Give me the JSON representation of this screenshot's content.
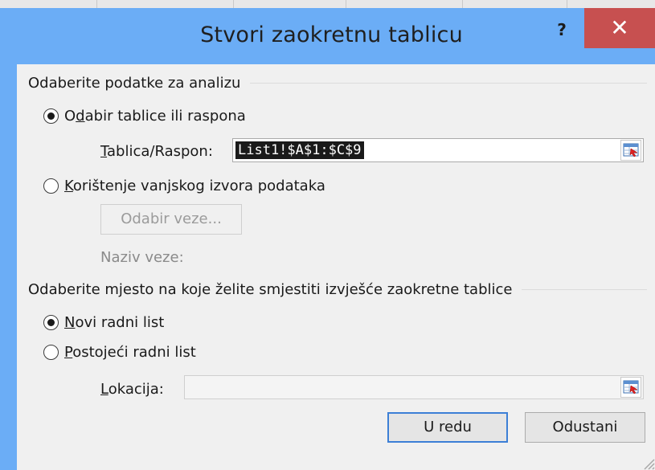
{
  "dialog": {
    "title": "Stvori zaokretnu tablicu",
    "help_label": "?",
    "close_label": "✕"
  },
  "section_data": {
    "label": "Odaberite podatke za analizu",
    "option_table": {
      "pre": "O",
      "accel": "d",
      "post": "abir tablice ili raspona",
      "selected": true
    },
    "range_label": {
      "accel": "T",
      "post": "ablica/Raspon:"
    },
    "range_value": "List1!$A$1:$C$9",
    "option_external": {
      "pre": "",
      "accel": "K",
      "post": "orištenje vanjskog izvora podataka",
      "selected": false
    },
    "choose_connection_label": "Odabir veze...",
    "connection_name_label": "Naziv veze:"
  },
  "section_location": {
    "label": "Odaberite mjesto na koje želite smjestiti izvješće zaokretne tablice",
    "option_new": {
      "pre": "",
      "accel": "N",
      "post": "ovi radni list",
      "selected": true
    },
    "option_existing": {
      "pre": "",
      "accel": "P",
      "post": "ostojeći radni list",
      "selected": false
    },
    "location_label": {
      "accel": "L",
      "post": "okacija:"
    },
    "location_value": ""
  },
  "buttons": {
    "ok_label": "U redu",
    "cancel_label": "Odustani"
  },
  "icons": {
    "collapse": "range-collapse-icon",
    "grip": "resize-grip-icon"
  },
  "colors": {
    "frame": "#6badf6",
    "close": "#c75050",
    "client": "#f0f0f0",
    "default_button_border": "#3c7fd6"
  }
}
